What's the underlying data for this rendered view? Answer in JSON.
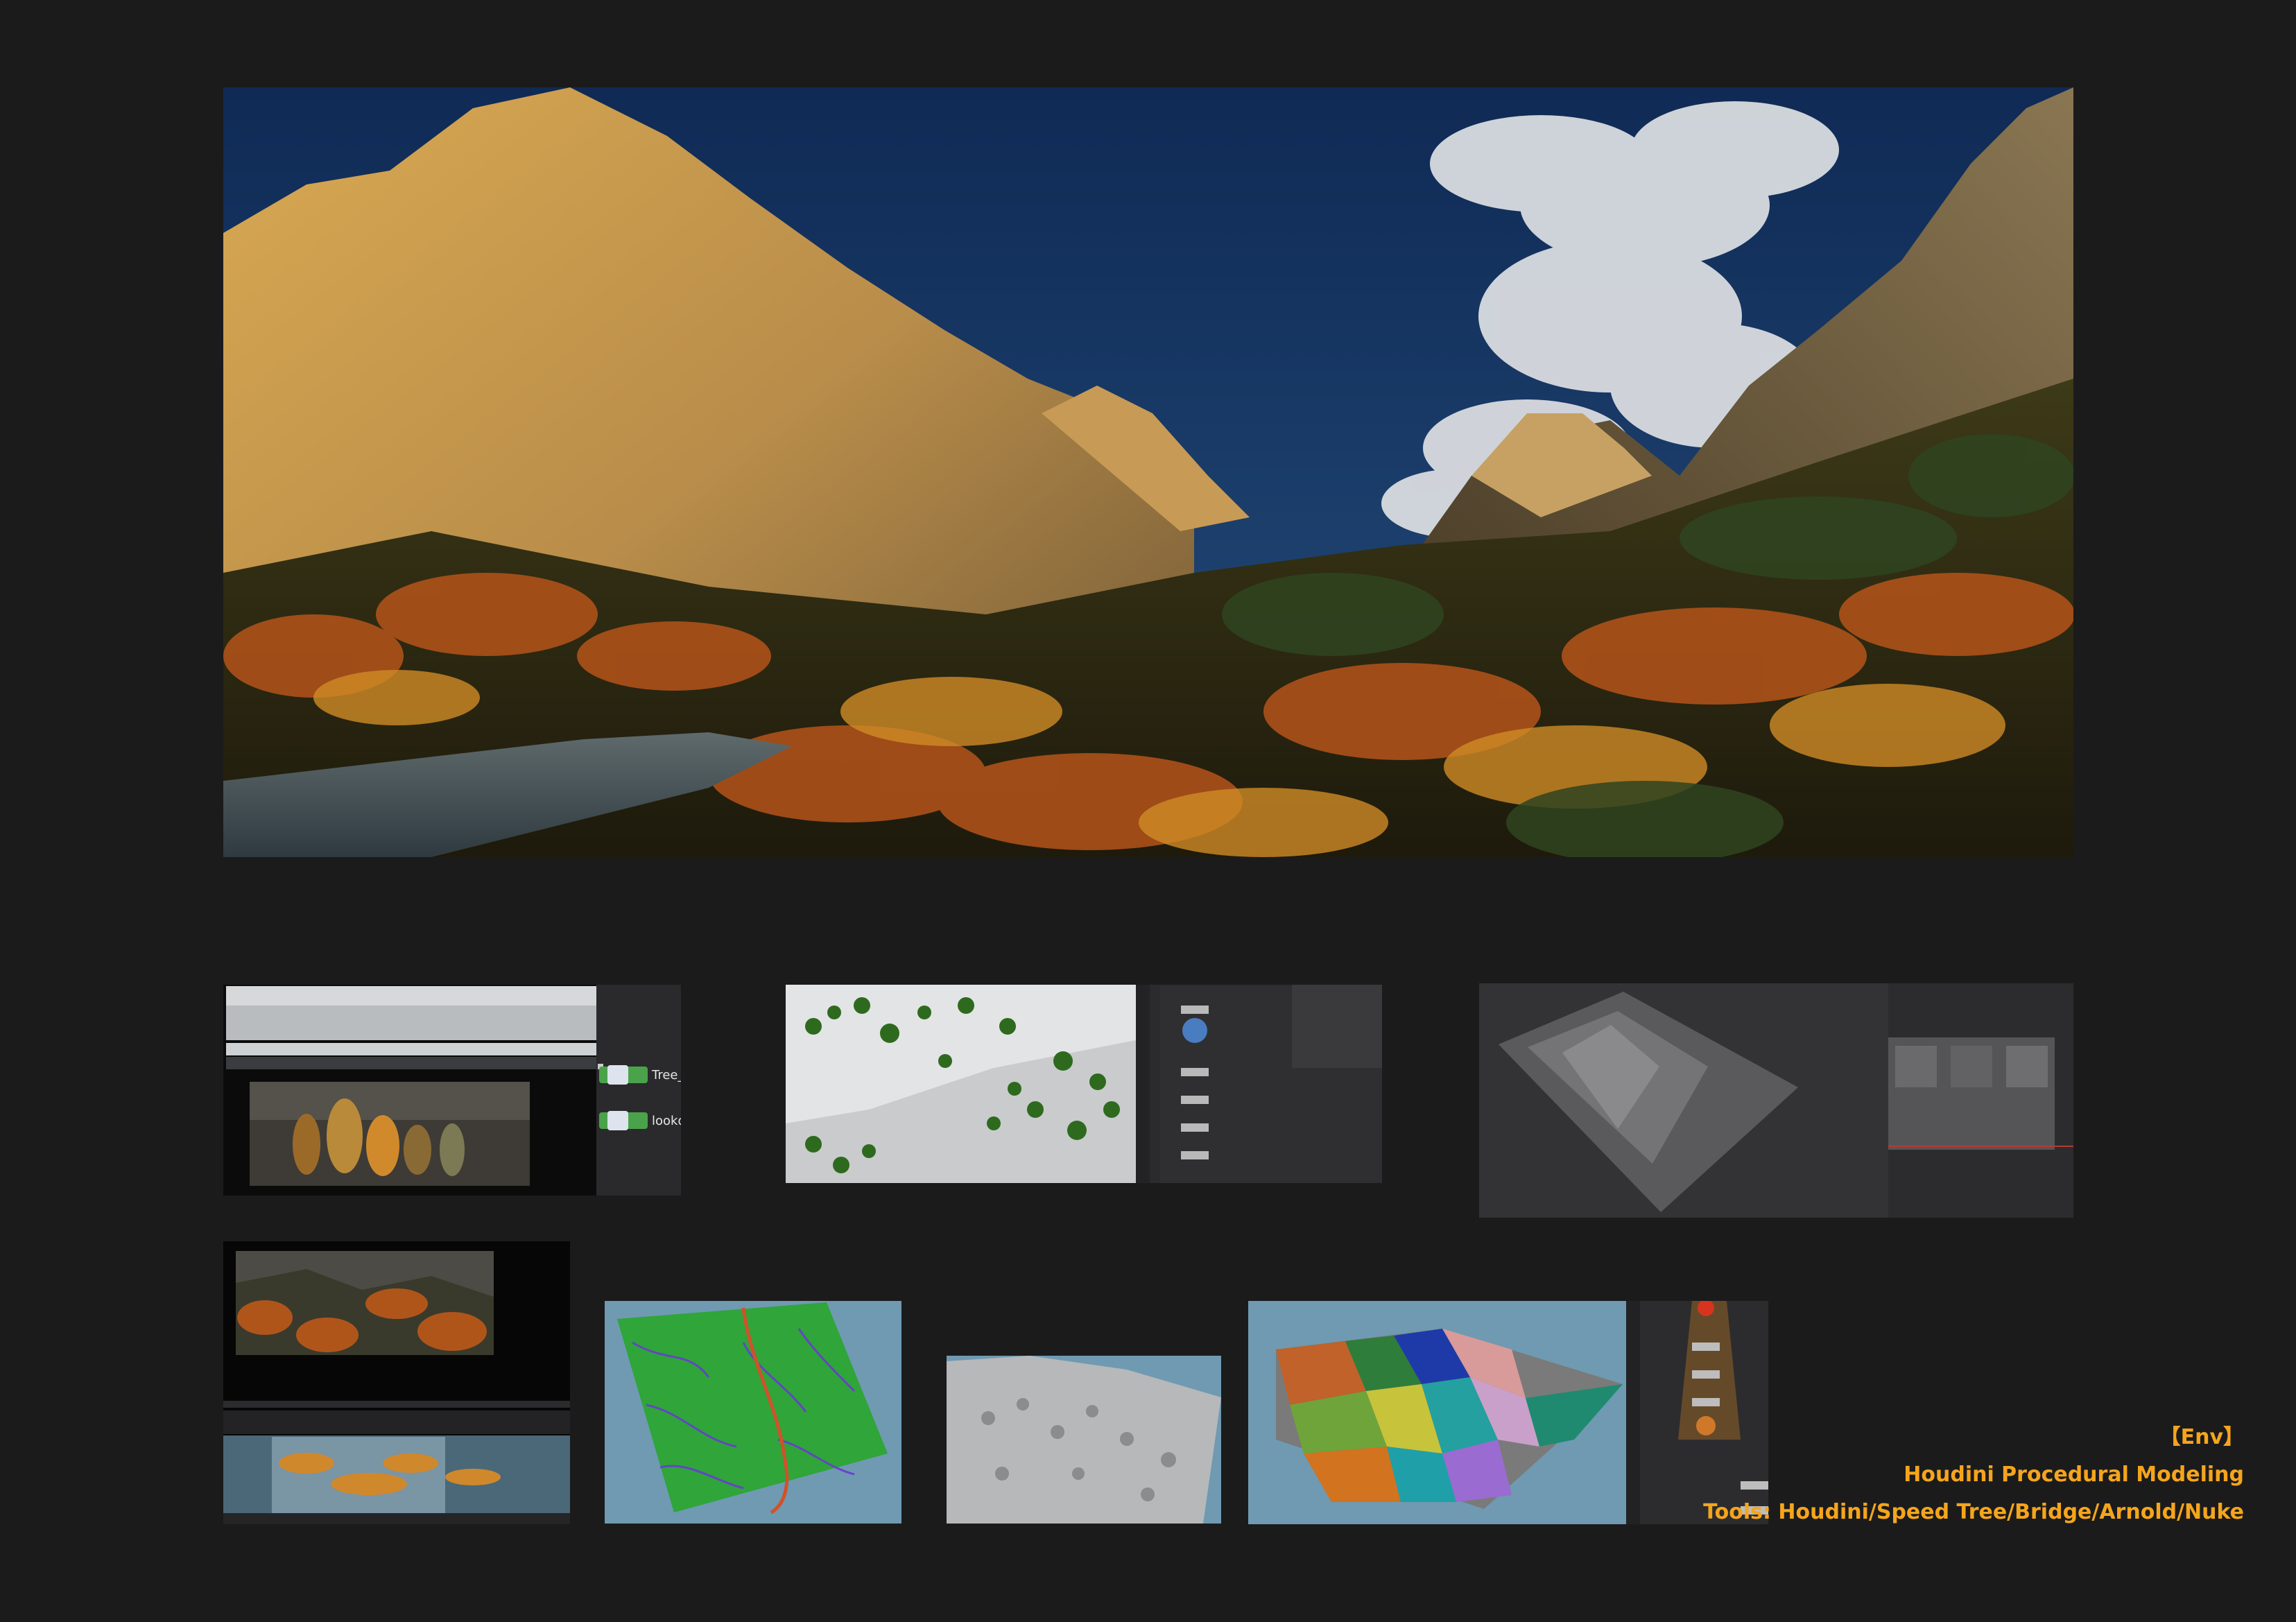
{
  "caption": {
    "tag": "【Env】",
    "title": "Houdini Procedural Modeling",
    "tools": "Tools: Houdini/Speed Tree/Bridge/Arnold/Nuke"
  },
  "thumbnails": {
    "speedtree_nodes": [
      "Tree_",
      "lookd"
    ]
  },
  "colors": {
    "background": "#1b1b1c",
    "caption": "#f5a51c"
  }
}
